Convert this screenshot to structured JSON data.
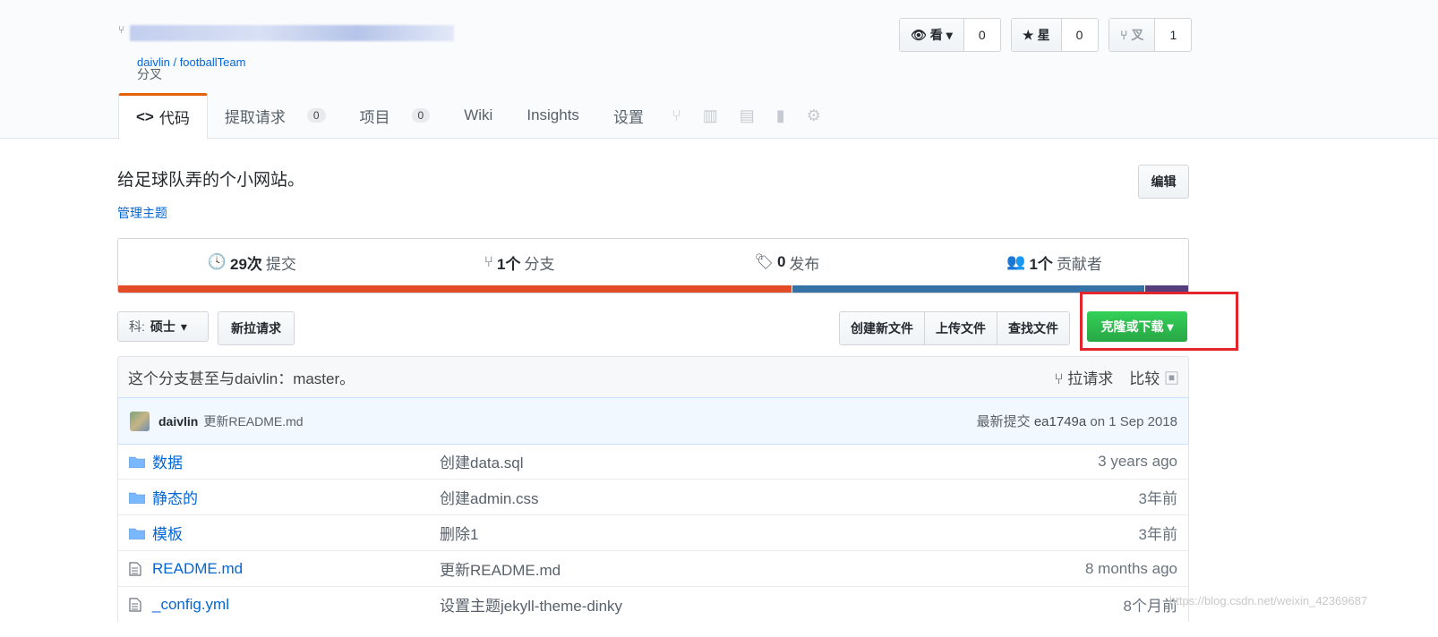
{
  "repo": {
    "parent": "daivlin / footballTeam",
    "fork_label": "分叉"
  },
  "actions": [
    {
      "label": "看",
      "count": "0"
    },
    {
      "label": "星",
      "count": "0"
    },
    {
      "label": "叉",
      "count": "1"
    }
  ],
  "tabs": {
    "code": "代码",
    "pulls": "提取请求",
    "pulls_count": "0",
    "projects": "项目",
    "projects_count": "0",
    "wiki": "Wiki",
    "insights": "Insights",
    "settings": "设置"
  },
  "description": "给足球队弄的个小网站。",
  "manage_topics": "管理主题",
  "edit_label": "编辑",
  "summary": {
    "commits_num": "29次",
    "commits_label": "提交",
    "branches_num": "1个",
    "branches_label": "分支",
    "releases_num": "0",
    "releases_label": "发布",
    "contributors_num": "1个",
    "contributors_label": "贡献者"
  },
  "language_bar": [
    {
      "color": "#e34c26",
      "share": 0.63
    },
    {
      "color": "#3572a5",
      "share": 0.33
    },
    {
      "color": "#563d7c",
      "share": 0.04
    }
  ],
  "toolbar": {
    "branch_prefix": "科:",
    "branch_name": "硕士",
    "new_pr": "新拉请求",
    "create_file": "创建新文件",
    "upload_files": "上传文件",
    "find_file": "查找文件",
    "clone": "克隆或下载"
  },
  "branch_info": {
    "text": "这个分支甚至与daivlin：master。",
    "pull_request": "拉请求",
    "compare": "比较"
  },
  "latest_commit": {
    "author": "daivlin",
    "message": "更新README.md",
    "prefix": "最新提交",
    "sha": "ea1749a",
    "date": "on 1 Sep 2018"
  },
  "files": [
    {
      "type": "dir",
      "name": "数据",
      "message": "创建data.sql",
      "age": "3 years ago"
    },
    {
      "type": "dir",
      "name": "静态的",
      "message": "创建admin.css",
      "age": "3年前"
    },
    {
      "type": "dir",
      "name": "模板",
      "message": "删除1",
      "age": "3年前"
    },
    {
      "type": "file",
      "name": "README.md",
      "message": "更新README.md",
      "age": "8 months ago"
    },
    {
      "type": "file",
      "name": "_config.yml",
      "message": "设置主题jekyll-theme-dinky",
      "age": "8个月前"
    }
  ],
  "watermark": "https://blog.csdn.net/weixin_42369687"
}
